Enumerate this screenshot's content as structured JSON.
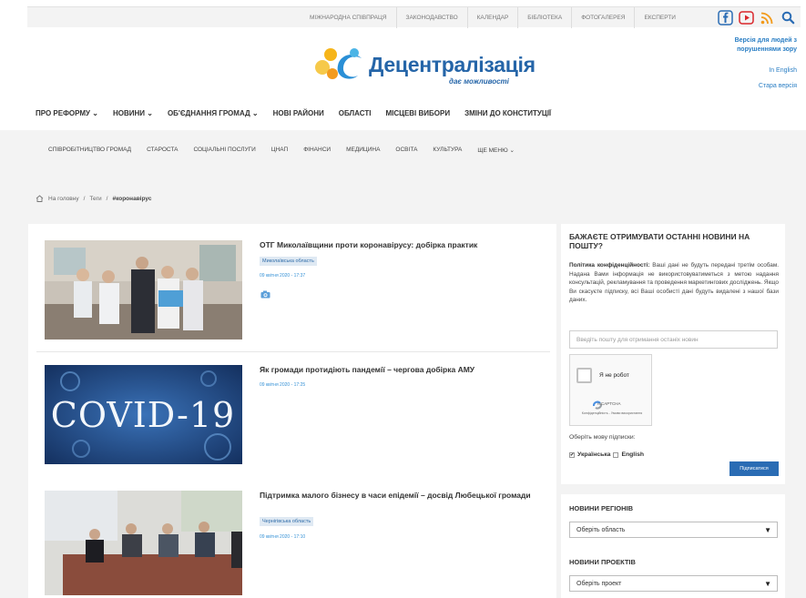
{
  "topbar": {
    "links": [
      "МІЖНАРОДНА СПІВПРАЦЯ",
      "ЗАКОНОДАВСТВО",
      "КАЛЕНДАР",
      "БІБЛІОТЕКА",
      "ФОТОГАЛЕРЕЯ",
      "ЕКСПЕРТИ"
    ]
  },
  "header": {
    "logo_text": "Децентралізація",
    "logo_sub": "дає можливості",
    "accessibility": "Версія для людей з порушеннями зору",
    "english": "In English",
    "old_version": "Стара версія"
  },
  "mainnav": [
    "ПРО РЕФОРМУ ⌄",
    "НОВИНИ ⌄",
    "ОБ'ЄДНАННЯ ГРОМАД ⌄",
    "НОВІ РАЙОНИ",
    "ОБЛАСТІ",
    "МІСЦЕВІ ВИБОРИ",
    "ЗМІНИ ДО КОНСТИТУЦІЇ"
  ],
  "subnav": [
    "СПІВРОБІТНИЦТВО ГРОМАД",
    "СТАРОСТА",
    "СОЦІАЛЬНІ ПОСЛУГИ",
    "ЦНАП",
    "ФІНАНСИ",
    "МЕДИЦИНА",
    "ОСВІТА",
    "КУЛЬТУРА",
    "ЩЕ МЕНЮ ⌄"
  ],
  "breadcrumb": {
    "home": "На головну",
    "tags": "Теги",
    "current": "#коронавірус"
  },
  "articles": [
    {
      "title": "ОТГ Миколаївщини проти коронавірусу: добірка практик",
      "tag": "Миколаївська область",
      "date": "09 квітня 2020 - 17:37"
    },
    {
      "title": "Як громади протидіють пандемії – чергова добірка АМУ",
      "date": "09 квітня 2020 - 17:25",
      "image_text": "COVID-19"
    },
    {
      "title": "Підтримка малого бізнесу в часи епідемії – досвід Любецької громади",
      "tag": "Чернігівська область",
      "date": "09 квітня 2020 - 17:10"
    }
  ],
  "newsletter": {
    "title": "БАЖАЄТЕ ОТРИМУВАТИ ОСТАННІ НОВИНИ НА ПОШТУ?",
    "policy_label": "Політика конфіденційності:",
    "policy_text": "Ваші дані не будуть передані третім особам. Надана Вами інформація не використовуватиметься з метою надання консультацій, рекламування та проведення маркетингових досліджень. Якщо Ви скасуєте підписку, всі Ваші особисті дані будуть видалені з нашої бази даних.",
    "email_placeholder": "Введіть пошту для отримання останіх новин",
    "captcha_label": "Я не робот",
    "captcha_brand": "reCAPTCHA",
    "captcha_terms": "Конфіденційність - Умови використання",
    "lang_label": "Оберіть мову підписки:",
    "lang_ua": "Українська",
    "lang_en": "English",
    "subscribe": "Підписатися"
  },
  "regions": {
    "title": "НОВИНИ РЕГІОНІВ",
    "select": "Оберіть область",
    "projects_title": "НОВИНИ ПРОЕКТІВ",
    "projects_select": "Оберіть проект"
  }
}
